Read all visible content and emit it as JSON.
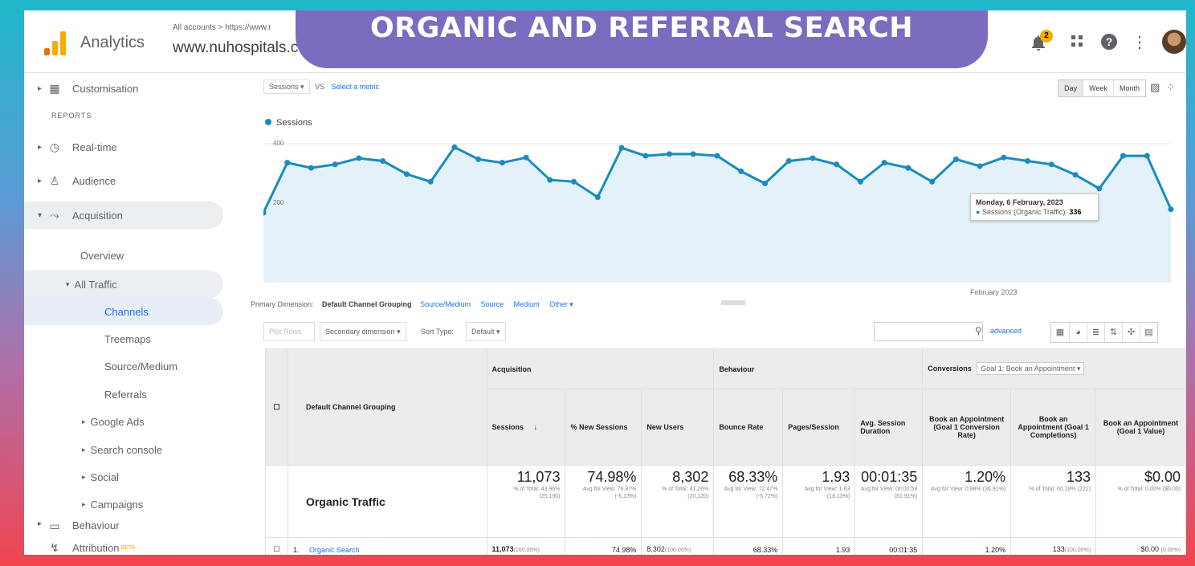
{
  "banner": {
    "text": "ORGANIC AND REFERRAL SEARCH"
  },
  "header": {
    "app_name": "Analytics",
    "breadcrumb": "All accounts > https://www.r",
    "property": "www.nuhospitals.c",
    "notification_count": "2"
  },
  "sidebar": {
    "reports_label": "REPORTS",
    "items": [
      {
        "label": "Customisation"
      },
      {
        "label": "Real-time"
      },
      {
        "label": "Audience"
      },
      {
        "label": "Acquisition"
      },
      {
        "label": "Overview"
      },
      {
        "label": "All Traffic"
      },
      {
        "label": "Channels"
      },
      {
        "label": "Treemaps"
      },
      {
        "label": "Source/Medium"
      },
      {
        "label": "Referrals"
      },
      {
        "label": "Google Ads"
      },
      {
        "label": "Search console"
      },
      {
        "label": "Social"
      },
      {
        "label": "Campaigns"
      },
      {
        "label": "Behaviour"
      },
      {
        "label": "Attribution",
        "badge": "BETA"
      }
    ]
  },
  "chart_controls": {
    "metric": "Sessions",
    "vs": "VS",
    "select_metric": "Select a metric",
    "periods": [
      "Day",
      "Week",
      "Month"
    ],
    "legend": "Sessions"
  },
  "chart_data": {
    "type": "line",
    "title": "",
    "series": [
      {
        "name": "Sessions",
        "values": [
          200,
          345,
          330,
          340,
          358,
          350,
          312,
          290,
          390,
          355,
          345,
          360,
          295,
          290,
          245,
          388,
          365,
          370,
          370,
          365,
          320,
          285,
          350,
          358,
          340,
          290,
          345,
          330,
          290,
          355,
          335,
          360,
          350,
          340,
          310,
          270,
          365,
          365,
          210
        ]
      }
    ],
    "ylim": [
      0,
      400
    ],
    "y_ticks": [
      "400",
      "200"
    ],
    "x_label": "February 2023",
    "tooltip_date": "Monday, 6 February, 2023",
    "tooltip_series": "Sessions (Organic Traffic):",
    "tooltip_value": "336",
    "color": "#1a8bbd"
  },
  "dimensions": {
    "label": "Primary Dimension:",
    "current": "Default Channel Grouping",
    "options": [
      "Source/Medium",
      "Source",
      "Medium",
      "Other"
    ]
  },
  "controls": {
    "plot_rows": "Plot Rows",
    "secondary": "Secondary dimension",
    "sort_label": "Sort Type:",
    "sort_value": "Default",
    "advanced": "advanced"
  },
  "table": {
    "groups": {
      "dimension": "Default Channel Grouping",
      "acquisition": "Acquisition",
      "behaviour": "Behaviour",
      "conversions": "Conversions",
      "goal": "Goal 1: Book an Appointment"
    },
    "columns": [
      "Sessions",
      "% New Sessions",
      "New Users",
      "Bounce Rate",
      "Pages/Session",
      "Avg. Session Duration",
      "Book an Appointment (Goal 1 Conversion Rate)",
      "Book an Appointment (Goal 1 Completions)",
      "Book an Appointment (Goal 1 Value)"
    ],
    "summary": {
      "label": "Organic Traffic",
      "values": [
        "11,073",
        "74.98%",
        "8,302",
        "68.33%",
        "1.93",
        "00:01:35",
        "1.20%",
        "133",
        "$0.00"
      ],
      "subs": [
        "% of Total: 43.96% (25,190)",
        "Avg for View: 79.87% (-6.13%)",
        "% of Total: 41.26% (20,120)",
        "Avg for View: 72.47% (-5.72%)",
        "Avg for View: 1.63 (18.13%)",
        "Avg for View: 00:00:59 (61.91%)",
        "Avg for View: 0.88% (36.91%)",
        "% of Total: 60.18% (221)",
        "% of Total: 0.00% ($0.00)"
      ]
    },
    "rows": [
      {
        "index": "1.",
        "label": "Organic Search",
        "values": [
          "11,073",
          "74.98%",
          "8,302",
          "68.33%",
          "1.93",
          "00:01:35",
          "1.20%",
          "133",
          "$0.00"
        ],
        "pcts": [
          "(100.00%)",
          "",
          "(100.00%)",
          "",
          "",
          "",
          "",
          "(100.00%)",
          "(0.00%)"
        ]
      }
    ]
  }
}
